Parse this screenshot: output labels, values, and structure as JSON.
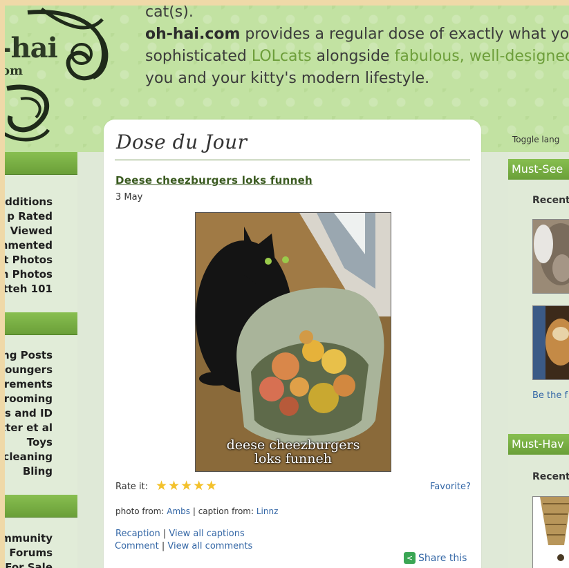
{
  "header": {
    "tagline_top": "cat(s).",
    "brand": "oh-hai.com",
    "tagline_line1_rest": " provides a regular dose of exactly what yo",
    "tagline_line2_a": "sophisticated ",
    "tagline_line2_lolcats": "LOLcats",
    "tagline_line2_b": " alongside ",
    "tagline_line2_fab": "fabulous, well-designed p",
    "tagline_line3": "you and your kitty's modern lifestyle.",
    "logo_hai": "-hai",
    "logo_com": "om"
  },
  "left_sidebar": {
    "section1": [
      "dditions",
      "p Rated",
      "Viewed",
      "nmented",
      "t Photos",
      "n Photos",
      "tteh 101"
    ],
    "section2": [
      "ng Posts",
      "oungers",
      "rements",
      "rooming",
      "s and ID",
      "tter et al",
      "Toys",
      "cleaning",
      "Bling"
    ],
    "section3": [
      "mmunity",
      "Forums",
      "For Sale"
    ]
  },
  "main": {
    "section_title": "Dose du Jour",
    "post_title": "Deese cheezburgers loks funneh",
    "post_date": "3 May",
    "image_caption_line1": "deese cheezburgers",
    "image_caption_line2": "loks funneh",
    "rate_label": "Rate it:",
    "rating_stars": 5,
    "stars_text": "★★★★★",
    "favorite_label": "Favorite?",
    "photo_from_label": "photo from:",
    "photo_from_user": "Ambs",
    "caption_from_label": "| caption from:",
    "caption_from_user": "Linnz",
    "recaption_label": "Recaption",
    "view_all_captions_label": "View all captions",
    "comment_label": "Comment",
    "view_all_comments_label": "View all comments",
    "share_label": "Share this",
    "separator": "|"
  },
  "right_sidebar": {
    "toggle_lang": "Toggle lang",
    "must_see_heading": "Must-See",
    "must_see_sub": "Recent",
    "be_first": "Be the f",
    "must_have_heading": "Must-Hav",
    "must_have_sub": "Recent"
  },
  "colors": {
    "accent_green": "#6a9f38",
    "link_blue": "#3467a6",
    "star_gold": "#f3c12b"
  }
}
